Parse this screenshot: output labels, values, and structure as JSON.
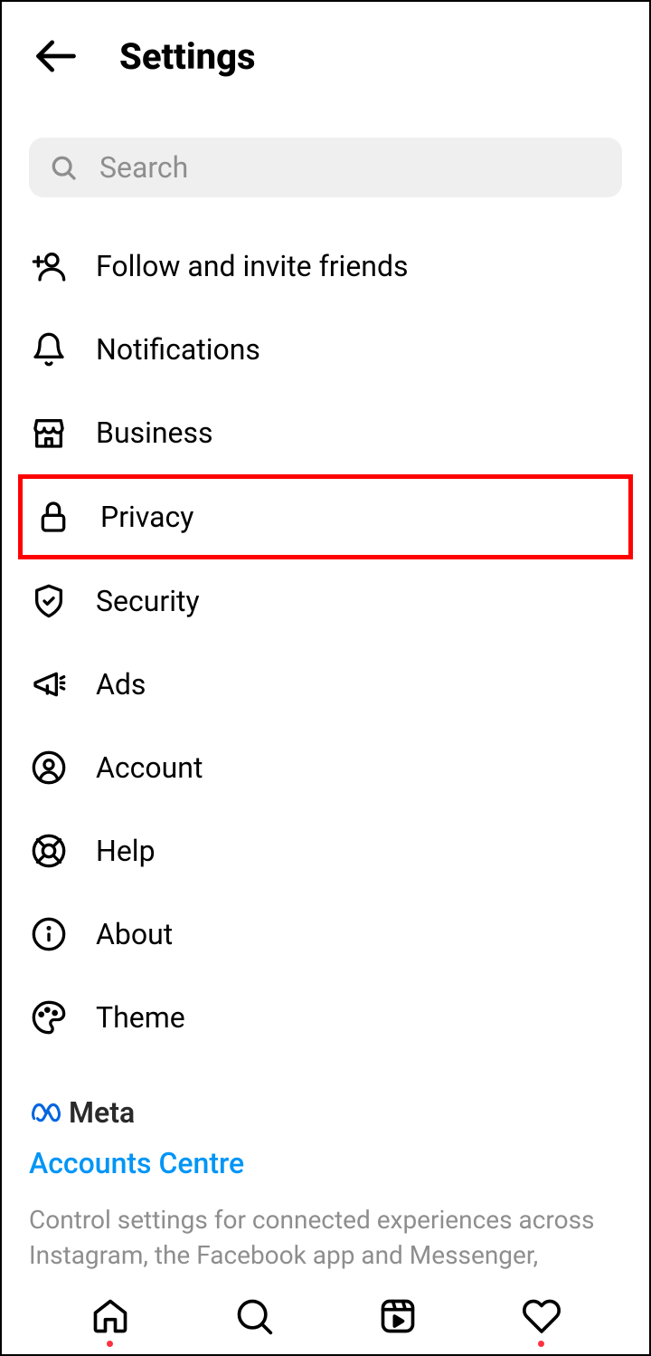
{
  "header": {
    "title": "Settings"
  },
  "search": {
    "placeholder": "Search"
  },
  "menu": {
    "items": [
      {
        "icon": "add-person-icon",
        "label": "Follow and invite friends"
      },
      {
        "icon": "bell-icon",
        "label": "Notifications"
      },
      {
        "icon": "shop-icon",
        "label": "Business"
      },
      {
        "icon": "lock-icon",
        "label": "Privacy",
        "highlighted": true
      },
      {
        "icon": "shield-check-icon",
        "label": "Security"
      },
      {
        "icon": "megaphone-icon",
        "label": "Ads"
      },
      {
        "icon": "account-circle-icon",
        "label": "Account"
      },
      {
        "icon": "lifebuoy-icon",
        "label": "Help"
      },
      {
        "icon": "info-icon",
        "label": "About"
      },
      {
        "icon": "palette-icon",
        "label": "Theme"
      }
    ]
  },
  "footer": {
    "meta_label": "Meta",
    "accounts_centre": "Accounts Centre",
    "description": "Control settings for connected experiences across Instagram, the Facebook app and Messenger, including"
  },
  "nav": {
    "items": [
      "home",
      "search",
      "reels",
      "activity"
    ]
  },
  "colors": {
    "highlight": "#ff0000",
    "link": "#0095f6",
    "meta_blue": "#0064e0"
  }
}
